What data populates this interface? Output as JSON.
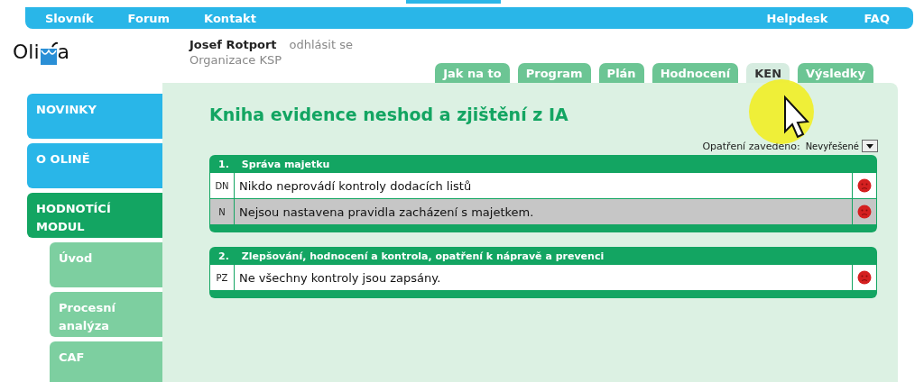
{
  "top_nav": {
    "left": [
      "Slovník",
      "Forum",
      "Kontakt"
    ],
    "right": [
      "Helpdesk",
      "FAQ"
    ]
  },
  "logo": {
    "text_left": "Oli",
    "text_right": "a"
  },
  "user": {
    "name": "Josef Rotport",
    "logout": "odhlásit se",
    "organization": "Organizace KSP"
  },
  "tabs": [
    {
      "label": "Jak na to",
      "selected": false
    },
    {
      "label": "Program",
      "selected": false
    },
    {
      "label": "Plán",
      "selected": false
    },
    {
      "label": "Hodnocení",
      "selected": false
    },
    {
      "label": "KEN",
      "selected": true
    },
    {
      "label": "Výsledky",
      "selected": false
    }
  ],
  "sidebar": {
    "items": [
      {
        "label": "NOVINKY",
        "selected": false
      },
      {
        "label": "O OLINĚ",
        "selected": false
      },
      {
        "label": "HODNOTÍCÍ MODUL",
        "selected": true,
        "children": [
          {
            "label": "Úvod"
          },
          {
            "label": "Procesní analýza"
          },
          {
            "label": "CAF"
          }
        ]
      }
    ]
  },
  "content": {
    "title": "Kniha evidence neshod a zjištění z IA",
    "filter": {
      "label": "Opatření zavedeno:",
      "value": "Nevyřešené"
    },
    "groups": [
      {
        "number": "1.",
        "title": "Správa majetku",
        "rows": [
          {
            "code": "DN",
            "text": "Nikdo neprovádí kontroly dodacích listů",
            "selected": false
          },
          {
            "code": "N",
            "text": "Nejsou nastavena pravidla zacházení s majetkem.",
            "selected": true
          }
        ]
      },
      {
        "number": "2.",
        "title": "Zlepšování, hodnocení a kontrola, opatření k nápravě a prevenci",
        "rows": [
          {
            "code": "PZ",
            "text": "Ne všechny kontroly jsou zapsány.",
            "selected": false
          }
        ]
      }
    ]
  }
}
